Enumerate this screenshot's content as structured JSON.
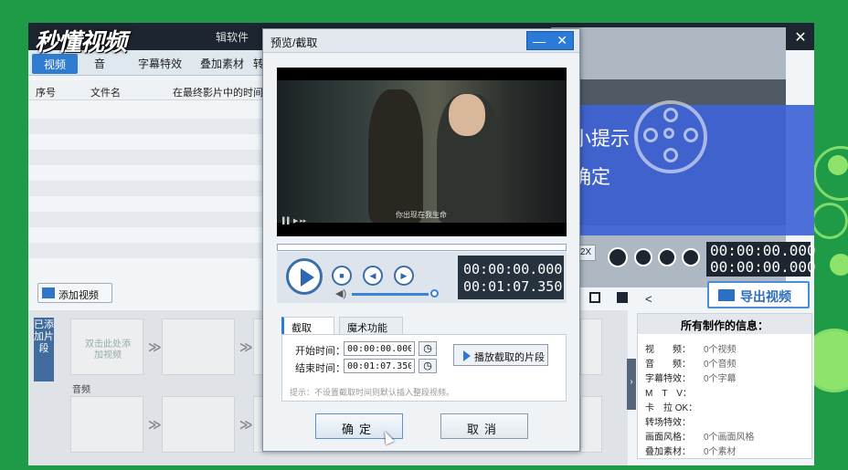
{
  "logo_text": "秒懂视频",
  "app": {
    "title_fragment": "辑软件",
    "window_controls": [
      "—",
      "⊡",
      "✕"
    ],
    "toolbar_tabs": [
      "视频",
      "音",
      "字幕特效",
      "叠加素材",
      "转"
    ],
    "list_columns": [
      "序号",
      "文件名",
      "在最终影片中的时间"
    ],
    "add_video_label": "添加视频",
    "added_clips_label": "已添加片段",
    "clip_placeholder": "双击此处添加视频",
    "audio_label": "音频",
    "speed_label": "2X",
    "time_current": "00:00:00.000",
    "time_total": "00:00:00.000",
    "export_label": "导出视频"
  },
  "info_panel": {
    "title": "所有制作的信息：",
    "rows": [
      {
        "label": "视　　频：",
        "value": "0个视频"
      },
      {
        "label": "音　　频：",
        "value": "0个音频"
      },
      {
        "label": "字幕特效：",
        "value": "0个字幕"
      },
      {
        "label": "M　T　V：",
        "value": ""
      },
      {
        "label": "卡　拉 OK：",
        "value": ""
      },
      {
        "label": "转场特效：",
        "value": ""
      },
      {
        "label": "画面风格：",
        "value": "0个画面风格"
      },
      {
        "label": "叠加素材：",
        "value": "0个素材"
      }
    ]
  },
  "tip_overlay": {
    "title": "小提示",
    "confirm": "确定"
  },
  "dialog": {
    "title": "预览/截取",
    "controls": [
      "—",
      "✕"
    ],
    "subtitle": "你出现在我生命",
    "time_current": "00:00:00.000",
    "time_total": "00:01:07.350",
    "tabs": [
      "截取",
      "魔术功能"
    ],
    "start_label": "开始时间：",
    "start_value": "00:00:00.000",
    "end_label": "结束时间：",
    "end_value": "00:01:07.350",
    "play_clip_label": "播放截取的片段",
    "hint": "提示：不设置截取时间则默认插入整段视频。",
    "ok_label": "确定",
    "cancel_label": "取消",
    "progress": 0.0,
    "volume": 0.95
  },
  "colors": {
    "background": "#1f9a46",
    "accent": "#2b7bd6",
    "titlebar": "#1d2630"
  }
}
